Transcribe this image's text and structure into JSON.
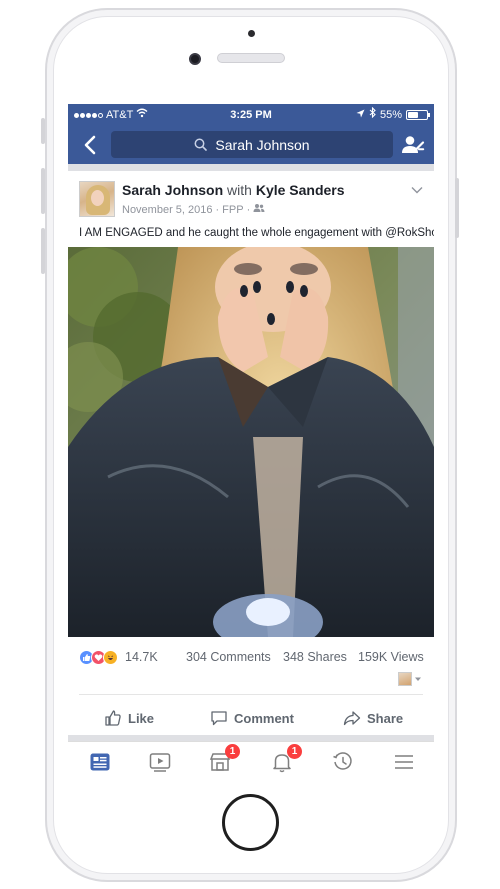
{
  "status_bar": {
    "carrier": "AT&T",
    "time": "3:25 PM",
    "battery": "55%",
    "battery_level": 0.55,
    "signal_bars": 4
  },
  "nav": {
    "search_text": "Sarah Johnson",
    "icons": [
      "back-chevron-icon",
      "search-icon",
      "friend-request-icon"
    ]
  },
  "post": {
    "author": "Sarah Johnson",
    "with_label": "with",
    "tagged": "Kyle Sanders",
    "date": "November 5, 2016",
    "audience": "FPP",
    "text": "I AM ENGAGED and he caught the whole engagement with @RokShok!",
    "reactions": {
      "types": [
        "like",
        "love",
        "haha"
      ],
      "count": "14.7K"
    },
    "comments": "304 Comments",
    "shares": "348 Shares",
    "views": "159K Views"
  },
  "actions": {
    "like": "Like",
    "comment": "Comment",
    "share": "Share"
  },
  "tabbar": {
    "tabs": [
      {
        "name": "news-feed",
        "icon": "news-feed-icon",
        "badge": ""
      },
      {
        "name": "video",
        "icon": "video-icon",
        "badge": ""
      },
      {
        "name": "marketplace",
        "icon": "marketplace-icon",
        "badge": "1"
      },
      {
        "name": "notifications",
        "icon": "bell-icon",
        "badge": "1"
      },
      {
        "name": "memories",
        "icon": "clock-history-icon",
        "badge": ""
      },
      {
        "name": "menu",
        "icon": "hamburger-menu-icon",
        "badge": ""
      }
    ]
  },
  "colors": {
    "brand": "#3b5998",
    "search_bg": "#2d4373",
    "active_tab": "#4267b2",
    "badge": "#fa3e3e"
  }
}
